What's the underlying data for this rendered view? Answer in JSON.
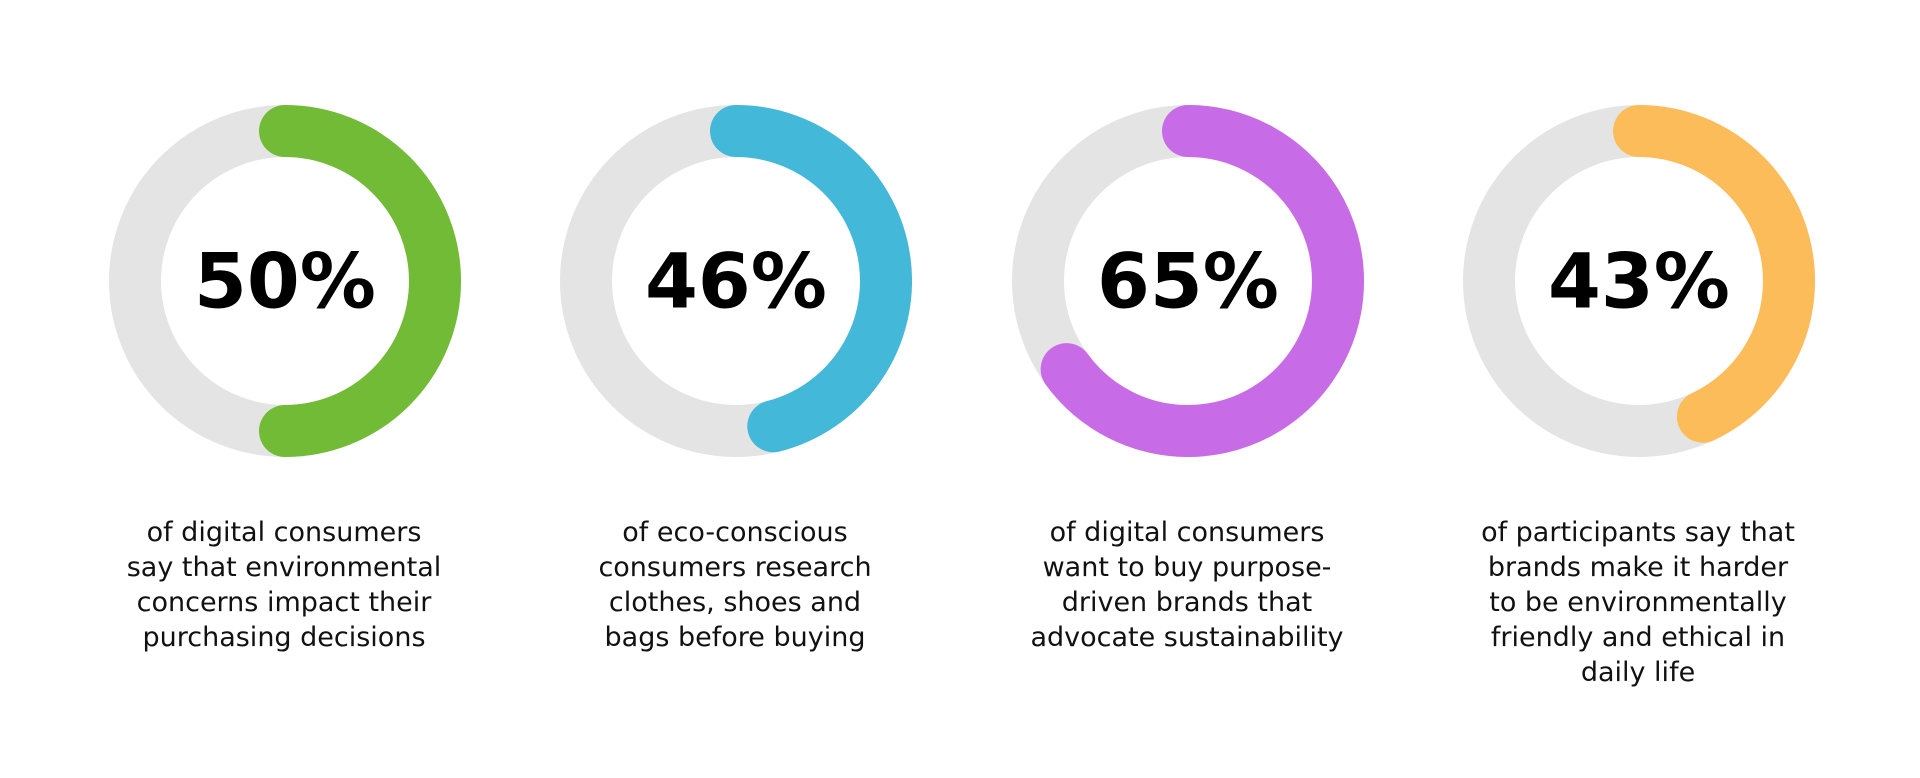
{
  "chart_data": [
    {
      "type": "pie",
      "value": 50,
      "label": "50%",
      "color": "#72bb36",
      "track_color": "#e4e4e4",
      "caption": [
        "of digital consumers",
        "say that environmental",
        "concerns impact their",
        "purchasing decisions"
      ]
    },
    {
      "type": "pie",
      "value": 46,
      "label": "46%",
      "color": "#43b8d8",
      "track_color": "#e4e4e4",
      "caption": [
        "of eco-conscious",
        "consumers research",
        "clothes, shoes and",
        "bags before buying"
      ]
    },
    {
      "type": "pie",
      "value": 65,
      "label": "65%",
      "color": "#c86be6",
      "track_color": "#e4e4e4",
      "caption": [
        "of digital consumers",
        "want to buy purpose-",
        "driven brands that",
        "advocate sustainability"
      ]
    },
    {
      "type": "pie",
      "value": 43,
      "label": "43%",
      "color": "#fdbc5a",
      "track_color": "#e4e4e4",
      "caption": [
        "of participants say that",
        "brands make it harder",
        "to be environmentally",
        "friendly and ethical in",
        "daily life"
      ]
    }
  ]
}
